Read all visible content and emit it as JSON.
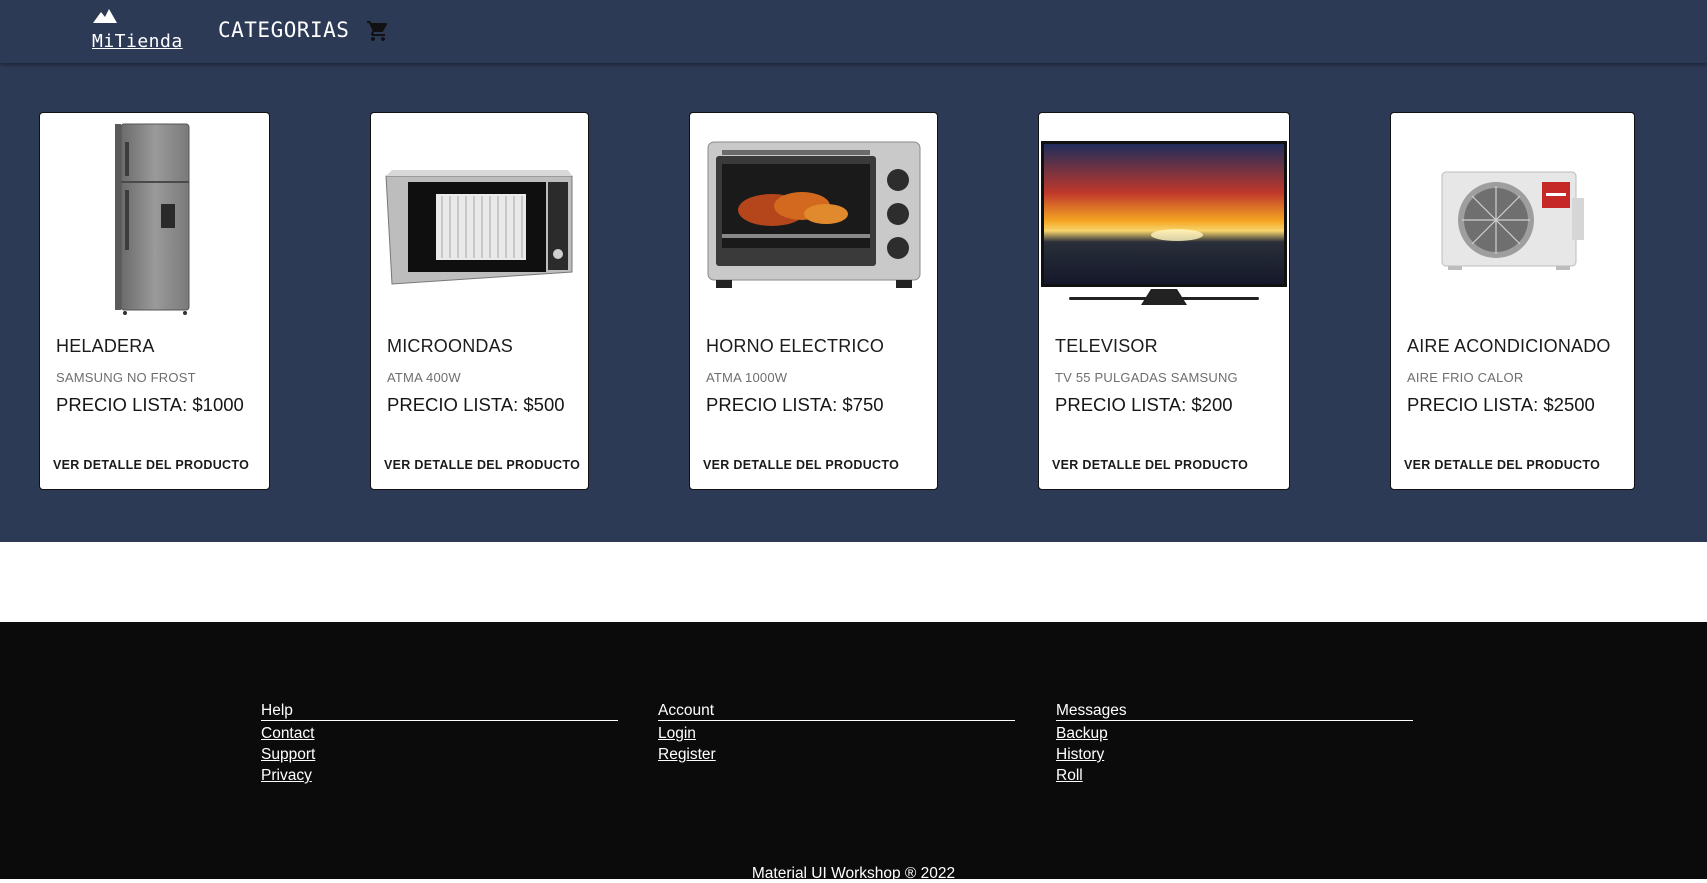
{
  "navbar": {
    "brand": "MiTienda",
    "brand_icon": "mountain-icon",
    "categories_label": "CATEGORIAS",
    "cart_icon": "shopping-cart-icon"
  },
  "products": [
    {
      "title": "HELADERA",
      "subtitle": "SAMSUNG NO FROST",
      "price": "PRECIO LISTA: $1000",
      "action": "VER DETALLE DEL PRODUCTO",
      "image": "refrigerator-image"
    },
    {
      "title": "MICROONDAS",
      "subtitle": "ATMA 400W",
      "price": "PRECIO LISTA: $500",
      "action": "VER DETALLE DEL PRODUCTO",
      "image": "microwave-image"
    },
    {
      "title": "HORNO ELECTRICO",
      "subtitle": "ATMA 1000W",
      "price": "PRECIO LISTA: $750",
      "action": "VER DETALLE DEL PRODUCTO",
      "image": "electric-oven-image"
    },
    {
      "title": "TELEVISOR",
      "subtitle": "TV 55 PULGADAS SAMSUNG",
      "price": "PRECIO LISTA: $200",
      "action": "VER DETALLE DEL PRODUCTO",
      "image": "television-image"
    },
    {
      "title": "AIRE ACONDICIONADO",
      "subtitle": "AIRE FRIO CALOR",
      "price": "PRECIO LISTA: $2500",
      "action": "VER DETALLE DEL PRODUCTO",
      "image": "air-conditioner-image"
    }
  ],
  "footer": {
    "columns": [
      {
        "heading": "Help",
        "links": [
          "Contact",
          "Support",
          "Privacy"
        ]
      },
      {
        "heading": "Account",
        "links": [
          "Login",
          "Register"
        ]
      },
      {
        "heading": "Messages",
        "links": [
          "Backup",
          "History",
          "Roll"
        ]
      }
    ],
    "copyright": "Material UI Workshop ® 2022"
  },
  "colors": {
    "primary": "#2d3a55",
    "footer_bg": "#0b0b0c",
    "card_bg": "#ffffff"
  }
}
